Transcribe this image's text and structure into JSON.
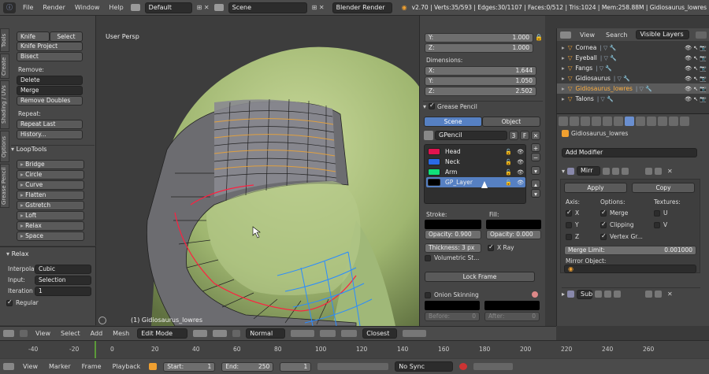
{
  "topbar": {
    "menus": [
      "File",
      "Render",
      "Window",
      "Help"
    ],
    "layout": "Default",
    "scene": "Scene",
    "engine": "Blender Render",
    "stats": "v2.70 | Verts:35/593 | Edges:30/1107 | Faces:0/512 | Tris:1024 | Mem:258.88M | Gidiosaurus_lowres"
  },
  "left_tools": {
    "tabs": [
      "Tools",
      "Create",
      "Shading / UVs",
      "Options",
      "Grease Pencil"
    ],
    "knife": "Knife",
    "select": "Select",
    "knife_project": "Knife Project",
    "bisect": "Bisect",
    "remove_label": "Remove:",
    "delete": "Delete",
    "merge": "Merge",
    "remove_doubles": "Remove Doubles",
    "repeat_label": "Repeat:",
    "repeat_last": "Repeat Last",
    "history": "History...",
    "looptools_title": "LoopTools",
    "looptools": [
      "Bridge",
      "Circle",
      "Curve",
      "Flatten",
      "Gstretch",
      "Loft",
      "Relax",
      "Space"
    ]
  },
  "relax_panel": {
    "title": "Relax",
    "interpolation_label": "Interpola",
    "interpolation": "Cubic",
    "input_label": "Input:",
    "input": "Selection",
    "iteration_label": "Iteration",
    "iteration": "1",
    "regular": "Regular"
  },
  "viewport": {
    "view_name": "User Persp",
    "object_name": "(1) Gidiosaurus_lowres"
  },
  "properties_n": {
    "y_label": "Y:",
    "y_val": "1.000",
    "z_label": "Z:",
    "z_val": "1.000",
    "dimensions_title": "Dimensions:",
    "dx_label": "X:",
    "dx_val": "1.644",
    "dy_label": "Y:",
    "dy_val": "1.050",
    "dz_label": "Z:",
    "dz_val": "2.502",
    "gp_title": "Grease Pencil",
    "gp_scene_tab": "Scene",
    "gp_object_tab": "Object",
    "gp_name": "GPencil",
    "gp_users": "3",
    "gp_f": "F",
    "layers": [
      {
        "name": "Head",
        "color": "#e0134f"
      },
      {
        "name": "Neck",
        "color": "#2a6ae6"
      },
      {
        "name": "Arm",
        "color": "#11e07a"
      },
      {
        "name": "GP_Layer",
        "color": "#000000"
      }
    ],
    "stroke_label": "Stroke:",
    "fill_label": "Fill:",
    "stroke_opacity": "Opacity:  0.900",
    "fill_opacity": "Opacity:  0.000",
    "thickness": "Thickness:  3 px",
    "xray": "X Ray",
    "volumetric": "Volumetric St...",
    "lock_frame": "Lock Frame",
    "onion": "Onion Skinning",
    "before": "Before:",
    "before_val": "0",
    "after": "After:",
    "after_val": "0"
  },
  "outliner": {
    "menus": [
      "View",
      "Search"
    ],
    "filter": "Visible Layers",
    "items": [
      "Cornea",
      "Eyeball",
      "Fangs",
      "Gidiosaurus",
      "Gidiosaurus_lowres",
      "Talons"
    ]
  },
  "modifiers": {
    "object_name": "Gidiosaurus_lowres",
    "add_modifier": "Add Modifier",
    "mirror_name": "Mirr",
    "apply": "Apply",
    "copy": "Copy",
    "axis_label": "Axis:",
    "options_label": "Options:",
    "textures_label": "Textures:",
    "axes": [
      "X",
      "Y",
      "Z"
    ],
    "options": [
      "Merge",
      "Clipping",
      "Vertex Gr..."
    ],
    "textures": [
      "U",
      "V"
    ],
    "merge_limit": "Merge Limit:",
    "merge_limit_val": "0.001000",
    "mirror_object": "Mirror Object:",
    "sub_name": "Sub"
  },
  "view3d_header": {
    "menus": [
      "View",
      "Select",
      "Add",
      "Mesh"
    ],
    "mode": "Edit Mode",
    "orientation": "Normal",
    "snap": "Closest"
  },
  "timeline": {
    "ticks": [
      "-40",
      "-20",
      "0",
      "20",
      "40",
      "60",
      "80",
      "100",
      "120",
      "140",
      "160",
      "180",
      "200",
      "220",
      "240",
      "260"
    ],
    "menus": [
      "View",
      "Marker",
      "Frame",
      "Playback"
    ],
    "start": "Start:",
    "start_val": "1",
    "end": "End:",
    "end_val": "250",
    "current": "1",
    "sync": "No Sync"
  }
}
